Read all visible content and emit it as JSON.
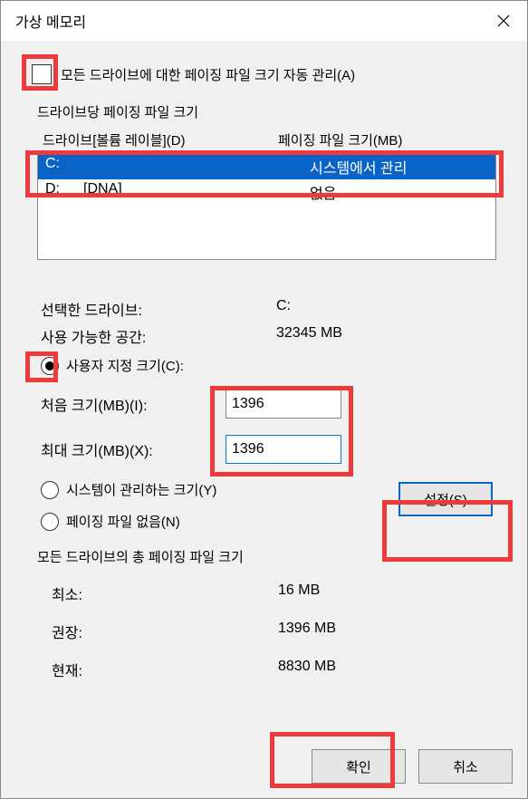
{
  "title": "가상 메모리",
  "auto_manage_label": "모든 드라이브에 대한 페이징 파일 크기 자동 관리(A)",
  "group_drive_label": "드라이브당 페이징 파일 크기",
  "col_drive": "드라이브[볼륨 레이블](D)",
  "col_size": "페이징 파일 크기(MB)",
  "drives": [
    {
      "letter": "C:",
      "label": "",
      "size": "시스템에서 관리",
      "selected": true
    },
    {
      "letter": "D:",
      "label": "[DNA]",
      "size": "없음",
      "selected": false
    }
  ],
  "selected_label": "선택한 드라이브:",
  "selected_value": "C:",
  "avail_label": "사용 가능한 공간:",
  "avail_value": "32345 MB",
  "radio_custom": "사용자 지정 크기(C):",
  "initial_label": "처음 크기(MB)(I):",
  "initial_value": "1396",
  "max_label": "최대 크기(MB)(X):",
  "max_value": "1396",
  "radio_system": "시스템이 관리하는 크기(Y)",
  "radio_none": "페이징 파일 없음(N)",
  "set_btn": "설정(S)",
  "total_group": "모든 드라이브의 총 페이징 파일 크기",
  "min_label": "최소:",
  "min_value": "16 MB",
  "rec_label": "권장:",
  "rec_value": "1396 MB",
  "cur_label": "현재:",
  "cur_value": "8830 MB",
  "ok_btn": "확인",
  "cancel_btn": "취소"
}
